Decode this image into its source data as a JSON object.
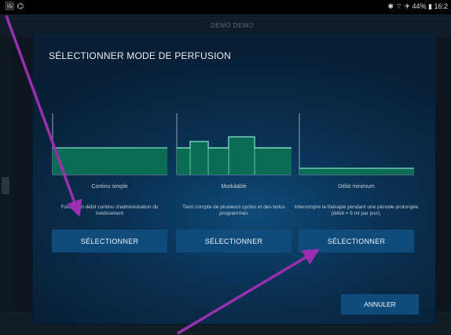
{
  "status_bar": {
    "left_icons": "🖼 ⌬",
    "right_text": "✱ ⌔ ✈ 44% ▮ 16:2"
  },
  "app_header": {
    "text": "DEMO DEMO"
  },
  "modal": {
    "title": "SÉLECTIONNER MODE DE PERFUSION",
    "options": [
      {
        "name": "Continu simple",
        "description": "Fournit un débit continu d'administration du médicament",
        "button_label": "SÉLECTIONNER",
        "diagram": "flat-continuous"
      },
      {
        "name": "Modulable",
        "description": "Tient compte de plusieurs cycles et des bolus programmés",
        "button_label": "SÉLECTIONNER",
        "diagram": "modulated-bolus"
      },
      {
        "name": "Débit minimum",
        "description": "Interrompre la thérapie pendant une période prolongée (débit = 5 ml par jour).",
        "button_label": "SÉLECTIONNER",
        "diagram": "minimum-flow"
      }
    ],
    "cancel_label": "ANNULER"
  },
  "colors": {
    "diagram_fill": "#0c6b55",
    "diagram_line": "#7ee0c2",
    "button_bg": "#0f4c7c",
    "annotation_arrow": "#9a2fb0"
  }
}
